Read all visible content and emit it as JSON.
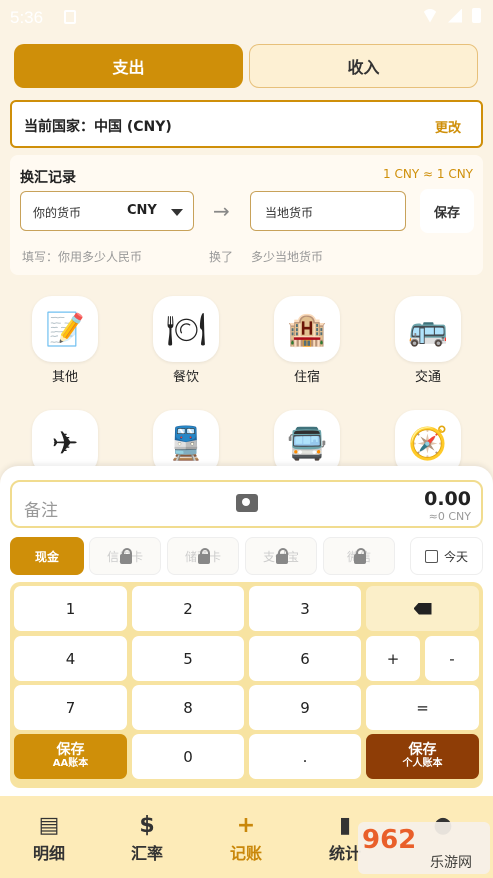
{
  "status_bar": {
    "time": "5:36"
  },
  "tabs": {
    "expense": "支出",
    "income": "收入"
  },
  "country": {
    "label": "当前国家：中国 (CNY)",
    "change": "更改"
  },
  "exchange": {
    "title": "换汇记录",
    "rate": "1 CNY ≈ 1 CNY",
    "your_currency_label": "你的货币",
    "your_currency_code": "CNY",
    "local_placeholder": "当地货币",
    "save": "保存",
    "hint_left": "填写：你用多少人民币",
    "hint_mid": "换了",
    "hint_right": "多少当地货币"
  },
  "categories": [
    {
      "label": "其他",
      "icon": "memo-icon",
      "glyph": "📝"
    },
    {
      "label": "餐饮",
      "icon": "dining-icon",
      "glyph": "🍽"
    },
    {
      "label": "住宿",
      "icon": "hotel-icon",
      "glyph": "🏨"
    },
    {
      "label": "交通",
      "icon": "bus-icon",
      "glyph": "🚌"
    },
    {
      "label": "",
      "icon": "airplane-icon",
      "glyph": "✈"
    },
    {
      "label": "",
      "icon": "train-icon",
      "glyph": "🚆"
    },
    {
      "label": "",
      "icon": "bus-front-icon",
      "glyph": "🚍"
    },
    {
      "label": "",
      "icon": "compass-icon",
      "glyph": "🧭"
    }
  ],
  "note": {
    "placeholder": "备注",
    "amount": "0.00",
    "converted": "≈0 CNY"
  },
  "payment": {
    "cash": "现金",
    "locked": [
      "信用卡",
      "储蓄卡",
      "支付宝",
      "微信"
    ],
    "date": "今天"
  },
  "keypad": {
    "keys": [
      "1",
      "2",
      "3",
      "4",
      "5",
      "6",
      "7",
      "8",
      "9",
      "0",
      "."
    ],
    "plus": "+",
    "minus": "-",
    "equals": "=",
    "save_aa": "保存",
    "save_aa_sub": "AA账本",
    "save_personal": "保存",
    "save_personal_sub": "个人账本"
  },
  "nav": [
    {
      "label": "明细",
      "icon": "notebook-icon"
    },
    {
      "label": "汇率",
      "icon": "exchange-icon"
    },
    {
      "label": "记账",
      "icon": "plus-icon"
    },
    {
      "label": "统计",
      "icon": "bar-chart-icon"
    },
    {
      "label": "",
      "icon": "person-icon"
    }
  ],
  "watermark": {
    "brand": "962",
    "sub": "乐游网"
  },
  "colors": {
    "accent": "#cf8f09",
    "dark_accent": "#8e3d06",
    "background": "#fbf3e4"
  }
}
